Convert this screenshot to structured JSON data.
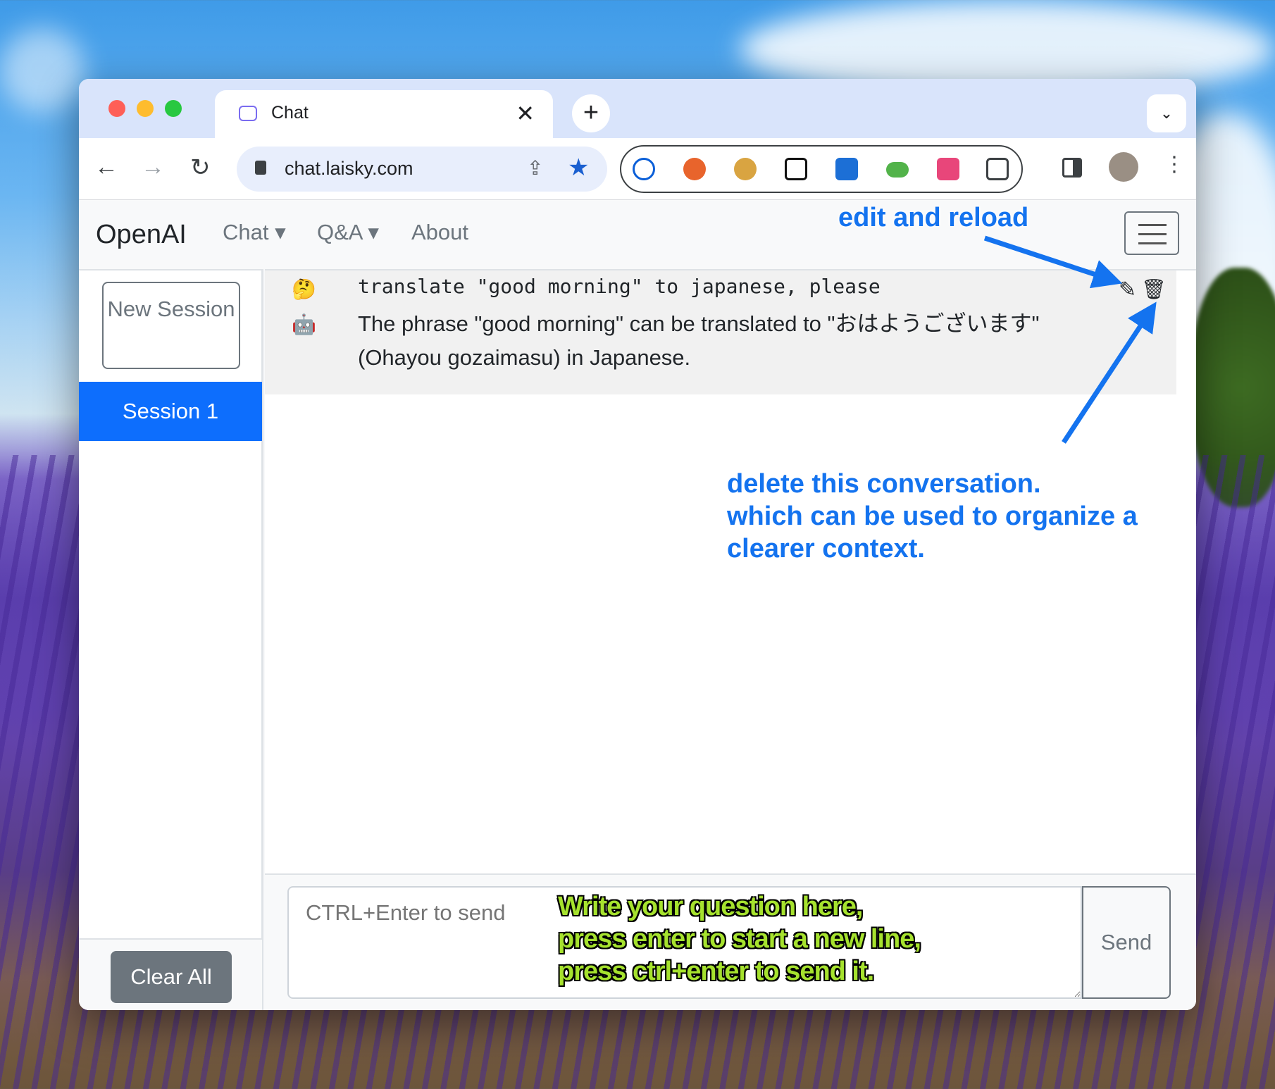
{
  "browser": {
    "tab_title": "Chat",
    "tab_close": "✕",
    "new_tab": "+",
    "tab_search": "⌄",
    "url": "chat.laisky.com",
    "back": "←",
    "forward": "→",
    "reload": "↻",
    "share": "⇪",
    "bookmark": "★",
    "menu": "⋮"
  },
  "navbar": {
    "brand": "OpenAI",
    "links": [
      "Chat ▾",
      "Q&A ▾",
      "About"
    ]
  },
  "sidebar": {
    "new_session": "New Session",
    "sessions": [
      "Session 1"
    ],
    "clear_all": "Clear All"
  },
  "conversation": {
    "user_icon": "🤔",
    "question": "translate \"good morning\" to japanese, please",
    "bot_icon": "🤖",
    "answer": "The phrase \"good morning\" can be translated to \"おはようございます\" (Ohayou gozaimasu) in Japanese.",
    "edit_icon": "✎",
    "delete_icon": "🗑"
  },
  "input": {
    "placeholder": "CTRL+Enter to send",
    "send_label": "Send"
  },
  "annotations": {
    "edit": "edit and reload",
    "delete_lines": [
      "delete this conversation.",
      "which can be used to organize a",
      "clearer context."
    ],
    "input_lines": [
      "Write your question here,",
      "press enter to start a new line,",
      "press ctrl+enter to send it."
    ]
  },
  "colors": {
    "accent": "#0d6efd",
    "annotation_blue": "#1473ef",
    "annotation_green": "#a6e22e"
  }
}
